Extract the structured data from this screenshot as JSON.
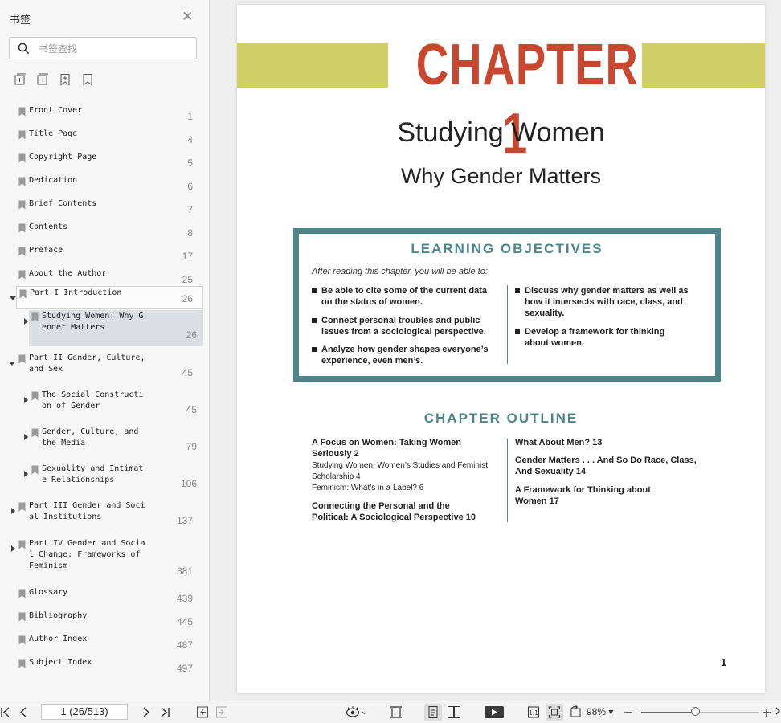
{
  "sidebar": {
    "title": "书签",
    "search_placeholder": "书签查找",
    "items": [
      {
        "label": "Front Cover",
        "page": "1"
      },
      {
        "label": "Title Page",
        "page": "4"
      },
      {
        "label": "Copyright Page",
        "page": "5"
      },
      {
        "label": "Dedication",
        "page": "6"
      },
      {
        "label": "Brief Contents",
        "page": "7"
      },
      {
        "label": "Contents",
        "page": "8"
      },
      {
        "label": "Preface",
        "page": "17"
      },
      {
        "label": "About the Author",
        "page": "25"
      },
      {
        "label": "Part I Introduction",
        "page": "26"
      },
      {
        "label": "Studying Women: Why G\nender Matters",
        "page": "26"
      },
      {
        "label": "Part II Gender, Culture,\nand Sex",
        "page": "45"
      },
      {
        "label": "The Social Constructi\non of Gender",
        "page": "45"
      },
      {
        "label": "Gender, Culture, and\nthe Media",
        "page": "79"
      },
      {
        "label": "Sexuality and Intimat\ne Relationships",
        "page": "106"
      },
      {
        "label": "Part III Gender and Soci\nal Institutions",
        "page": "137"
      },
      {
        "label": "Part IV Gender and Socia\nl Change: Frameworks of\nFeminism",
        "page": "381"
      },
      {
        "label": "Glossary",
        "page": "439"
      },
      {
        "label": "Bibliography",
        "page": "445"
      },
      {
        "label": "Author Index",
        "page": "487"
      },
      {
        "label": "Subject Index",
        "page": "497"
      }
    ]
  },
  "document": {
    "chapter_heading": "CHAPTER 1",
    "title": "Studying Women",
    "subtitle": "Why Gender Matters",
    "learning_objectives": {
      "heading": "LEARNING OBJECTIVES",
      "intro": "After reading this chapter, you will be able to:",
      "left": [
        "Be able to cite some of the current data\non the status of women.",
        "Connect personal troubles and public\nissues from a sociological perspective.",
        "Analyze how gender shapes everyone’s\nexperience, even men’s."
      ],
      "right": [
        "Discuss why gender matters as well as\nhow it intersects with race, class, and\nsexuality.",
        "Develop a framework for thinking\nabout women."
      ]
    },
    "chapter_outline": {
      "heading": "CHAPTER OUTLINE",
      "left": [
        {
          "text": "A Focus on Women: Taking Women\nSeriously   2",
          "kind": "main"
        },
        {
          "text": "Studying Women: Women’s Studies and Feminist\n      Scholarship   4",
          "kind": "sub"
        },
        {
          "text": "Feminism: What’s in a Label?   6",
          "kind": "sub"
        },
        {
          "text": "Connecting the Personal and the\nPolitical: A Sociological Perspective   10",
          "kind": "main"
        }
      ],
      "right": [
        {
          "text": "What About Men?   13",
          "kind": "main"
        },
        {
          "text": "Gender Matters . . . And So Do Race, Class,\nAnd Sexuality   14",
          "kind": "main"
        },
        {
          "text": "A Framework for Thinking about\nWomen   17",
          "kind": "main"
        }
      ]
    },
    "page_number": "1",
    "colors": {
      "accent_red": "#c9472e",
      "band_yellow": "#cfcf65",
      "teal": "#4d868a"
    }
  },
  "toolbar": {
    "page_field": "1 (26/513)",
    "zoom": "98%",
    "zoom_slider_fraction": 0.46
  }
}
